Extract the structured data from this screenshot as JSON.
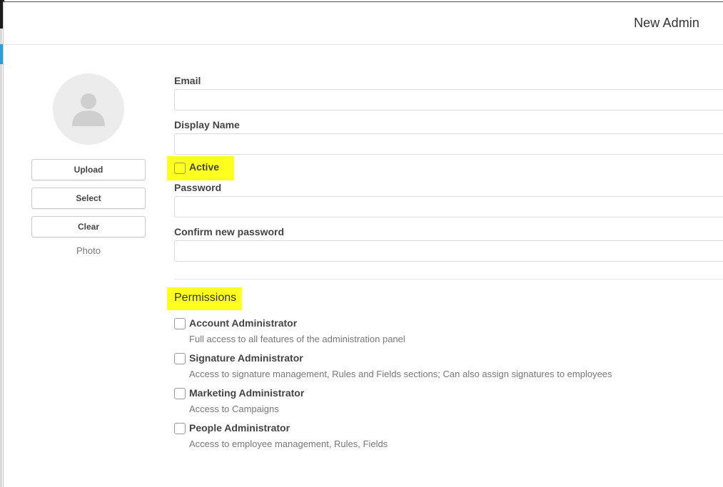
{
  "dialog": {
    "title": "New Admin"
  },
  "photo": {
    "upload_label": "Upload",
    "select_label": "Select",
    "clear_label": "Clear",
    "caption": "Photo"
  },
  "form": {
    "email": {
      "label": "Email",
      "value": ""
    },
    "display_name": {
      "label": "Display Name",
      "value": ""
    },
    "active": {
      "label": "Active",
      "checked": false
    },
    "password": {
      "label": "Password",
      "value": ""
    },
    "confirm_password": {
      "label": "Confirm new password",
      "value": ""
    }
  },
  "permissions": {
    "title": "Permissions",
    "items": [
      {
        "title": "Account Administrator",
        "description": "Full access to all features of the administration panel",
        "checked": false
      },
      {
        "title": "Signature Administrator",
        "description": "Access to signature management, Rules and Fields sections; Can also assign signatures to employees",
        "checked": false
      },
      {
        "title": "Marketing Administrator",
        "description": "Access to Campaigns",
        "checked": false
      },
      {
        "title": "People Administrator",
        "description": "Access to employee management, Rules, Fields",
        "checked": false
      }
    ]
  },
  "colors": {
    "highlight": "#ffff20",
    "avatar_bg": "#ececec",
    "avatar_fg": "#cfcfcf"
  },
  "icons": {
    "avatar": "user-silhouette-icon"
  }
}
